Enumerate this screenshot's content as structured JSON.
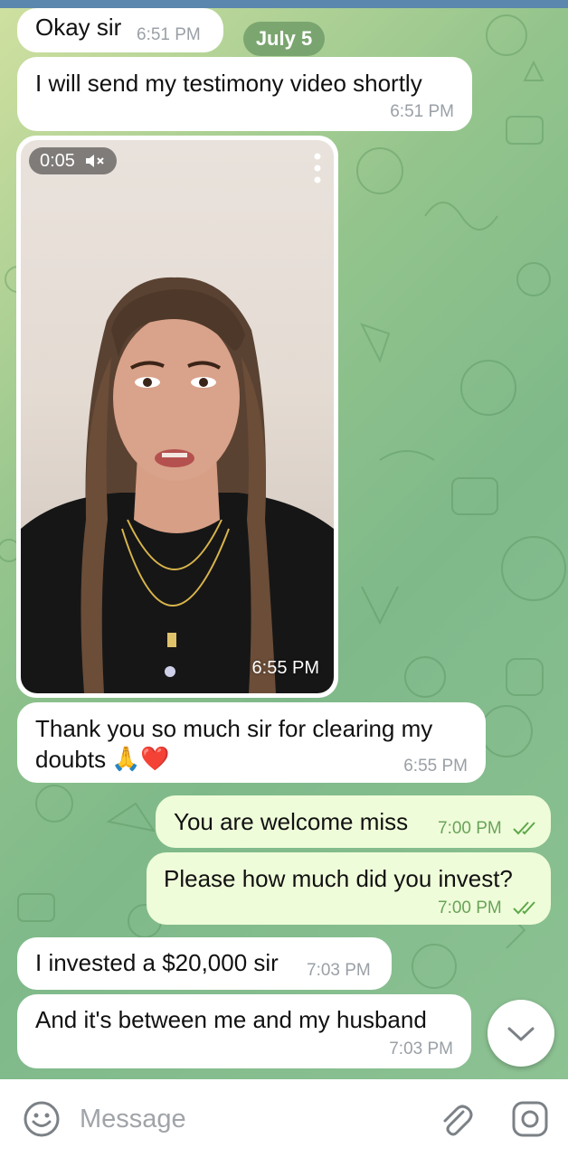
{
  "chat": {
    "date_pill": "July 5",
    "messages": [
      {
        "text": "Okay sir",
        "time": "6:51 PM"
      },
      {
        "text": "I will send my testimony video shortly",
        "time": "6:51 PM"
      },
      {
        "video_duration": "0:05",
        "time": "6:55 PM"
      },
      {
        "text_line1": "Thank you so much sir for clearing my",
        "text_line2": "doubts",
        "emoji": "🙏❤️",
        "time": "6:55 PM"
      },
      {
        "text": "You are welcome miss",
        "time": "7:00 PM"
      },
      {
        "text": "Please how much did you invest?",
        "time": "7:00 PM"
      },
      {
        "text": "I invested a $20,000 sir",
        "time": "7:03 PM"
      },
      {
        "text": "And it's between me and my husband",
        "time": "7:03 PM"
      }
    ]
  },
  "input": {
    "placeholder": "Message"
  },
  "icons": {
    "emoji": "smiley-icon",
    "attach": "paperclip-icon",
    "camera": "instagram-camera-icon",
    "scroll": "chevron-down-icon",
    "mute": "speaker-muted-icon",
    "menu": "more-vertical-icon"
  },
  "colors": {
    "incoming_bubble": "#ffffff",
    "outgoing_bubble": "#effcd9",
    "checks": "#5ea84b",
    "top_bar": "#5b86ad"
  }
}
